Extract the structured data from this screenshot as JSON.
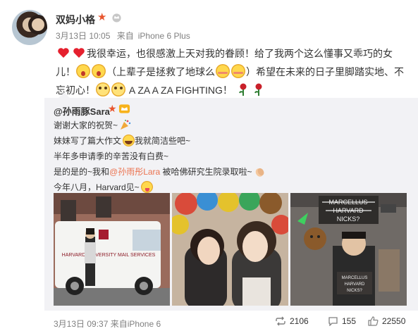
{
  "post": {
    "username": "双妈小格",
    "timestamp": "3月13日 10:05",
    "source_prefix": "来自",
    "source": "iPhone 6 Plus",
    "text_line1": "我很幸运，也很感激上天对我的眷顾！给了我两个这么懂事又乖巧的女",
    "text_line2_a": "儿！",
    "text_line2_b": "（上辈子是拯救了地球么",
    "text_line2_c": "）希望在未来的日子里脚踏实地、不",
    "text_line3_a": "忘初心！",
    "text_line3_b": " A ZA A ZA FIGHTING！"
  },
  "repost": {
    "author": "@孙雨豚Sara",
    "line1": "谢谢大家的祝贺~",
    "line2_a": "妹妹写了篇大作文",
    "line2_b": "我就简洁些吧~",
    "line3": "半年多申请季的辛苦没有白费~",
    "line4_a": "是的是的~我和",
    "line4_mention": "@孙雨彤Lara",
    "line4_b": " 被哈佛研究生院录取啦~",
    "line5_a": "今年八月，Harvard见~",
    "timestamp": "3月13日 09:37",
    "source_prefix": "来自",
    "source": "iPhone 6",
    "photo1_text": "HARVARD UNIVERSITY MAIL SERVICES",
    "photo3_text1": "MARCELLUS",
    "photo3_text2": "HARVARD",
    "photo3_text3": "NICKS?",
    "photo3_sign1": "MARCELLUS",
    "photo3_sign2": "HARVARD",
    "photo3_sign3": "NICKS?"
  },
  "stats": {
    "reposts": "2106",
    "comments": "155",
    "likes": "22550"
  },
  "colors": {
    "accent": "#eb7350",
    "badge": "#e8552e",
    "repost_bg": "#f2f2f5",
    "meta_text": "#808080"
  },
  "icons": {
    "verified": "star-verified-icon",
    "member": "crown-member-icon",
    "repost": "repost-icon",
    "comment": "comment-icon",
    "like": "thumbs-up-icon"
  }
}
